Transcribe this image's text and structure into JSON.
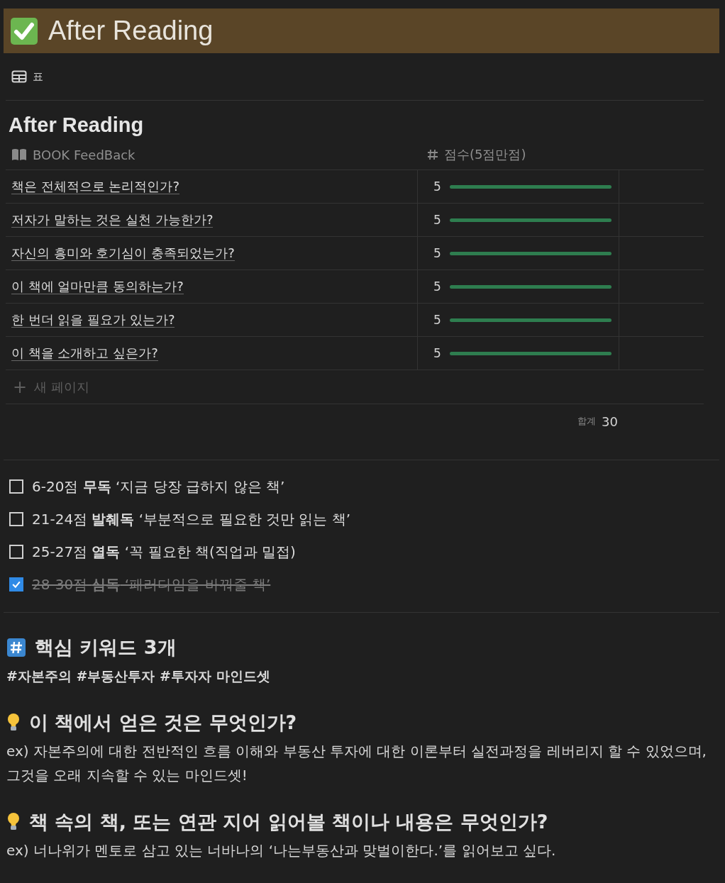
{
  "banner": {
    "title": "After Reading"
  },
  "view_tab": {
    "label": "표"
  },
  "database": {
    "title": "After Reading",
    "columns": [
      {
        "label": "BOOK FeedBack"
      },
      {
        "label": "점수(5점만점)"
      }
    ],
    "rows": [
      {
        "question": "책은 전체적으로 논리적인가?",
        "score": "5"
      },
      {
        "question": "저자가 말하는 것은 실천 가능한가?",
        "score": "5"
      },
      {
        "question": "자신의 흥미와 호기심이 충족되었는가?",
        "score": "5"
      },
      {
        "question": "이 책에 얼마만큼 동의하는가?",
        "score": "5"
      },
      {
        "question": "한 번더 읽을 필요가 있는가?",
        "score": "5"
      },
      {
        "question": "이 책을 소개하고 싶은가?",
        "score": "5"
      }
    ],
    "new_page": {
      "icon": "+",
      "label": "새 페이지"
    },
    "sum": {
      "label": "합계",
      "value": "30"
    }
  },
  "checklist": [
    {
      "text": "6-20점 **무독** ‘지금 당장 급하지 않은 책’",
      "checked": false
    },
    {
      "text": "21-24점 **발췌독** ‘부분적으로 필요한 것만 읽는 책’",
      "checked": false
    },
    {
      "text": "25-27점 **열독** ‘꼭 필요한 책(직업과 밀접)",
      "checked": false
    },
    {
      "text": "28-30점 **심독** ‘패러다임을 바꿔줄 책’",
      "checked": true
    }
  ],
  "sections": [
    {
      "kind": "hash",
      "heading": "핵심 키워드 3개",
      "body": "#자본주의 #부동산투자 #투자자 마인드셋"
    },
    {
      "kind": "bulb",
      "heading": "이 책에서 얻은 것은 무엇인가?",
      "body": "ex) 자본주의에 대한 전반적인 흐름 이해와 부동산 투자에 대한 이론부터 실전과정을 레버리지 할 수 있었으며, 그것을 오래 지속할 수 있는 마인드셋!"
    },
    {
      "kind": "bulb",
      "heading": "책 속의 책, 또는 연관 지어 읽어볼 책이나 내용은 무엇인가?",
      "body": "ex) 너나위가 멘토로 삼고 있는 너바나의 ‘나는부동산과 맞벌이한다.’를 읽어보고 싶다."
    }
  ]
}
